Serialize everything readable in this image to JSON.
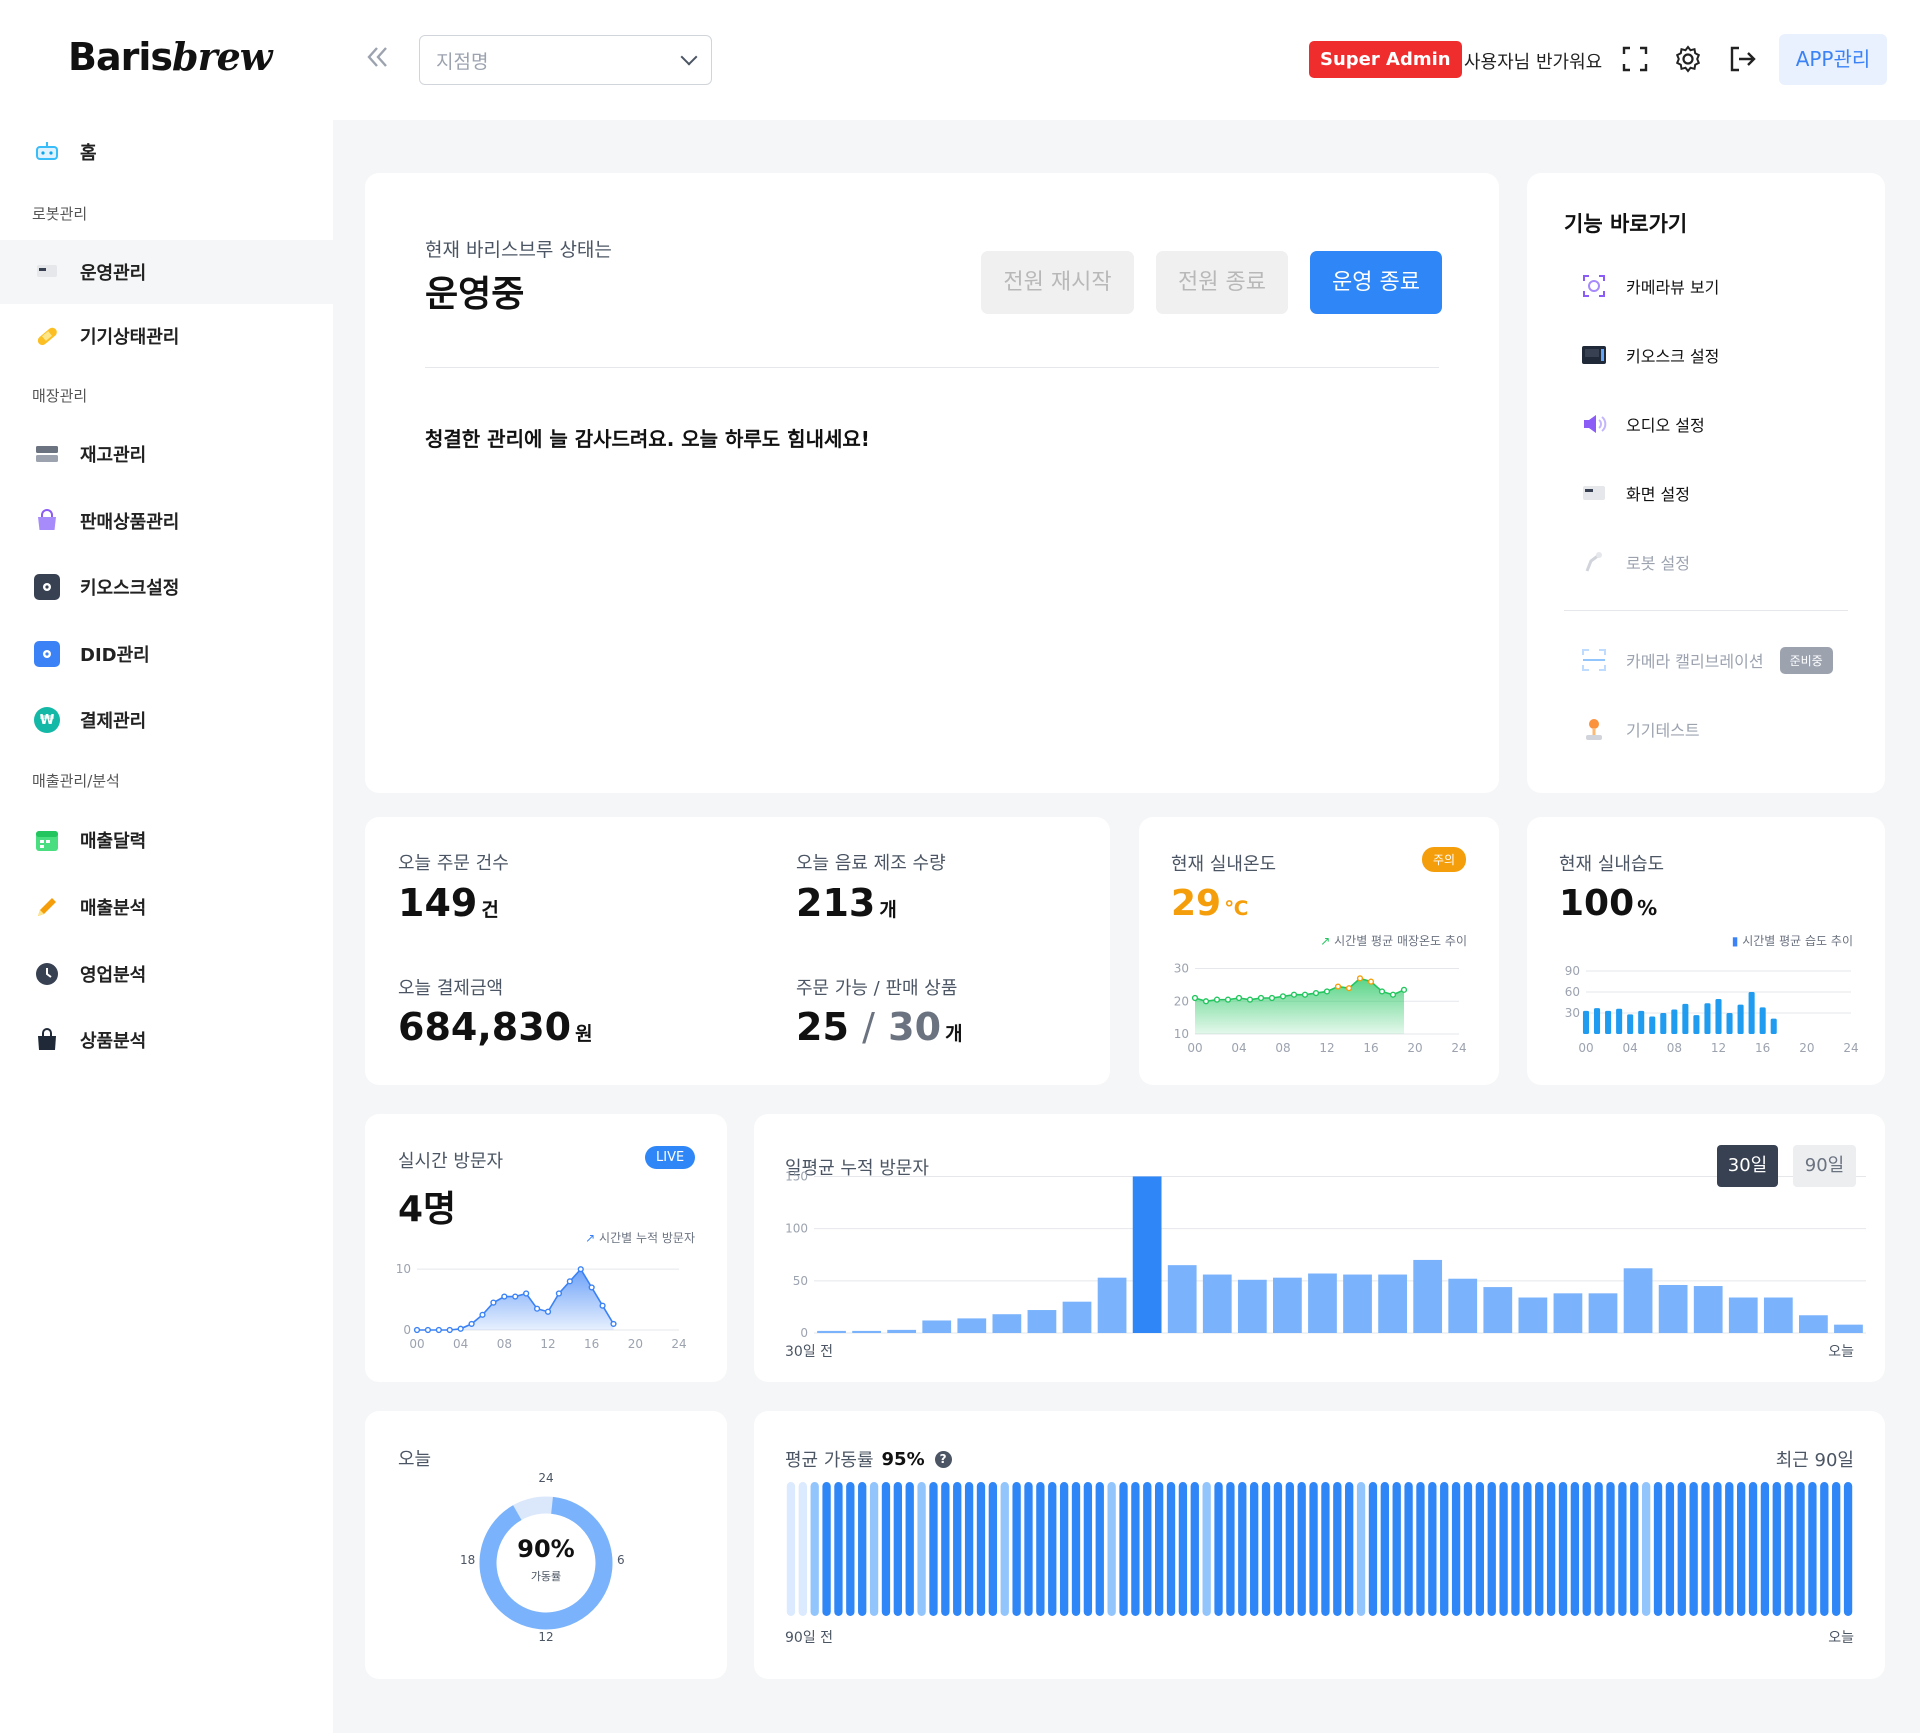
{
  "brand": {
    "part1": "Baris",
    "part2": "brew"
  },
  "header": {
    "store_placeholder": "지점명",
    "role_badge": "Super Admin",
    "greeting": "사용자님 반가워요",
    "app_button": "APP관리"
  },
  "sidebar": {
    "home": "홈",
    "sections": [
      "로봇관리",
      "매장관리",
      "매출관리/분석"
    ],
    "robot_items": [
      "운영관리",
      "기기상태관리"
    ],
    "store_items": [
      "재고관리",
      "판매상품관리",
      "키오스크설정",
      "DID관리",
      "결제관리"
    ],
    "sales_items": [
      "매출달력",
      "매출분석",
      "영업분석",
      "상품분석"
    ]
  },
  "status": {
    "caption": "현재 바리스브루 상태는",
    "value": "운영중",
    "btn_restart": "전원 재시작",
    "btn_power_off": "전원 종료",
    "btn_stop": "운영 종료",
    "message": "청결한 관리에 늘 감사드려요. 오늘 하루도 힘내세요!"
  },
  "shortcuts": {
    "title": "기능 바로가기",
    "items": [
      "카메라뷰 보기",
      "키오스크 설정",
      "오디오 설정",
      "화면 설정",
      "로봇 설정",
      "카메라 캘리브레이션",
      "기기테스트"
    ],
    "preparing_badge": "준비중"
  },
  "stats": {
    "orders_label": "오늘 주문 건수",
    "orders_value": "149",
    "orders_unit": "건",
    "drinks_label": "오늘 음료 제조 수량",
    "drinks_value": "213",
    "drinks_unit": "개",
    "payment_label": "오늘 결제금액",
    "payment_value": "684,830",
    "payment_unit": "원",
    "products_label": "주문 가능 / 판매 상품",
    "products_available": "25",
    "products_sep": "/",
    "products_total": "30",
    "products_unit": "개"
  },
  "temperature": {
    "label": "현재 실내온도",
    "badge": "주의",
    "value": "29",
    "unit": "℃",
    "legend": "시간별 평균 매장온도 추이"
  },
  "humidity": {
    "label": "현재 실내습도",
    "value": "100",
    "unit": "%",
    "legend": "시간별 평균 습도 추이"
  },
  "visitors": {
    "label": "실시간 방문자",
    "badge": "LIVE",
    "value": "4명",
    "legend": "시간별 누적 방문자"
  },
  "daily_visitors": {
    "title": "일평균 누적 방문자",
    "btn_30": "30일",
    "btn_90": "90일",
    "start_label": "30일 전",
    "end_label": "오늘"
  },
  "uptime_today": {
    "label": "오늘",
    "value": "90%",
    "caption": "가동률",
    "ticks": [
      "24",
      "6",
      "12",
      "18"
    ]
  },
  "uptime_avg": {
    "title_prefix": "평균 가동률",
    "title_value": "95%",
    "range_label": "최근 90일",
    "start_label": "90일 전",
    "end_label": "오늘"
  },
  "colors": {
    "primary": "#2f86f6",
    "danger": "#ef2d2d",
    "warning": "#f59e0b",
    "green": "#22c55e",
    "bar_light": "#7ab3fb"
  },
  "chart_data": [
    {
      "type": "area",
      "name": "temperature",
      "x": [
        0,
        1,
        2,
        3,
        4,
        5,
        6,
        7,
        8,
        9,
        10,
        11,
        12,
        13,
        14,
        15,
        16,
        17,
        18,
        19,
        20,
        21,
        22,
        23,
        24
      ],
      "values": [
        21,
        20,
        20.5,
        20.5,
        21,
        20.5,
        21,
        21,
        21.5,
        22,
        22,
        22.5,
        23,
        24.5,
        24,
        27,
        26,
        23,
        22,
        23.5,
        null,
        null,
        null,
        null,
        null
      ],
      "xticks": [
        "00",
        "04",
        "08",
        "12",
        "16",
        "20",
        "24"
      ],
      "yticks": [
        10,
        20,
        30
      ],
      "ylim": [
        10,
        32
      ]
    },
    {
      "type": "bar",
      "name": "humidity",
      "x": [
        0,
        1,
        2,
        3,
        4,
        5,
        6,
        7,
        8,
        9,
        10,
        11,
        12,
        13,
        14,
        15,
        16,
        17,
        18,
        19,
        20,
        21,
        22,
        23,
        24
      ],
      "values": [
        33,
        37,
        33,
        36,
        28,
        33,
        25,
        30,
        35,
        43,
        27,
        44,
        50,
        30,
        42,
        60,
        38,
        22,
        null,
        null,
        null,
        null,
        null,
        null,
        null
      ],
      "xticks": [
        "00",
        "04",
        "08",
        "12",
        "16",
        "20",
        "24"
      ],
      "yticks": [
        30,
        60,
        90
      ],
      "ylim": [
        0,
        100
      ]
    },
    {
      "type": "area",
      "name": "visitors",
      "x": [
        0,
        1,
        2,
        3,
        4,
        5,
        6,
        7,
        8,
        9,
        10,
        11,
        12,
        13,
        14,
        15,
        16,
        17,
        18,
        19,
        20,
        21,
        22,
        23,
        24
      ],
      "values": [
        0,
        0,
        0,
        0,
        0.2,
        1,
        2.5,
        4.5,
        5.5,
        5.5,
        6,
        3.5,
        3,
        6,
        8,
        10,
        7,
        4,
        1,
        null,
        null,
        null,
        null,
        null,
        null
      ],
      "xticks": [
        "00",
        "04",
        "08",
        "12",
        "16",
        "20",
        "24"
      ],
      "yticks": [
        0,
        10
      ],
      "ylim": [
        0,
        12
      ]
    },
    {
      "type": "bar",
      "name": "daily_visitors",
      "values": [
        2,
        2,
        3,
        12,
        14,
        18,
        22,
        30,
        53,
        150,
        65,
        56,
        51,
        53,
        57,
        56,
        56,
        70,
        52,
        44,
        34,
        38,
        38,
        62,
        46,
        45,
        34,
        34,
        17,
        8
      ],
      "highlight_index": 9,
      "yticks": [
        0,
        50,
        100,
        150
      ],
      "ylim": [
        0,
        160
      ]
    },
    {
      "type": "pie",
      "name": "uptime_today",
      "values": [
        90,
        10
      ]
    },
    {
      "type": "bar",
      "name": "uptime_90days",
      "levels": [
        0,
        0,
        1,
        2,
        2,
        2,
        2,
        1,
        2,
        2,
        2,
        1,
        2,
        2,
        2,
        2,
        2,
        2,
        1,
        2,
        2,
        2,
        2,
        2,
        2,
        2,
        2,
        1,
        2,
        2,
        2,
        2,
        2,
        2,
        2,
        1,
        2,
        2,
        2,
        2,
        2,
        2,
        2,
        2,
        2,
        2,
        2,
        2,
        1,
        2,
        2,
        2,
        2,
        2,
        2,
        2,
        2,
        2,
        2,
        2,
        2,
        2,
        2,
        2,
        2,
        2,
        2,
        2,
        2,
        2,
        2,
        2,
        1,
        2,
        2,
        2,
        2,
        2,
        2,
        2,
        2,
        2,
        2,
        2,
        2,
        2,
        2,
        2,
        2,
        2
      ],
      "level_meaning": "0=low,1=partial,2=full"
    }
  ]
}
